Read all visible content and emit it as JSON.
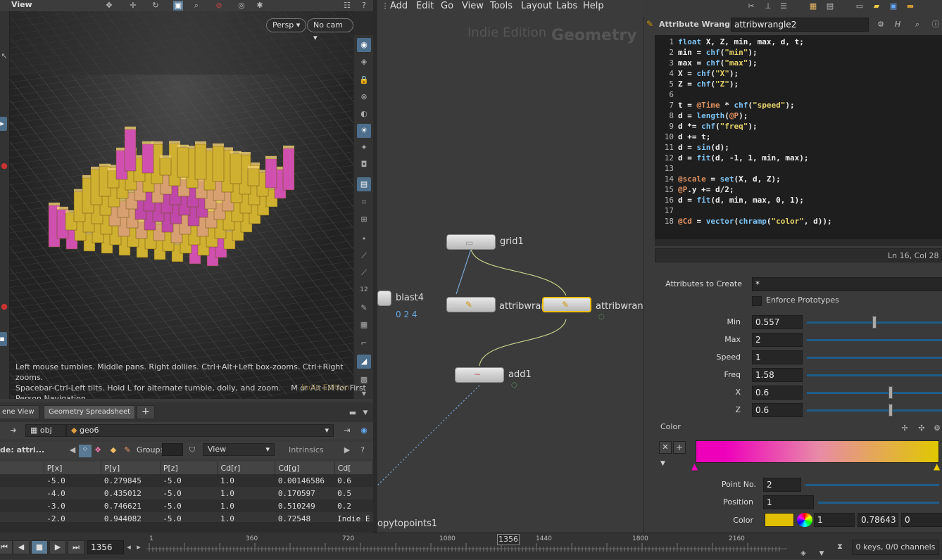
{
  "viewport": {
    "title": "View",
    "camera_view": "Persp",
    "camera": "No cam",
    "help_line1": "Left mouse tumbles. Middle pans. Right dollies. Ctrl+Alt+Left box-zooms. Ctrl+Right zooms.",
    "help_line2": "Spacebar-Ctrl-Left tilts. Hold L for alternate tumble, dolly, and zoom.    M or Alt+M for First",
    "help_line3": "Person Navigation.",
    "watermark": "Indie Edition"
  },
  "sheet": {
    "tabs": [
      "ene View",
      "Geometry Spreadsheet",
      "+"
    ],
    "path": [
      "obj",
      "geo6"
    ],
    "node_label": "de: attri...",
    "group_label": "Group:",
    "view_label": "View",
    "intrinsics_label": "Intrinsics",
    "headers": [
      "",
      "P[x]",
      "P[y]",
      "P[z]",
      "Cd[r]",
      "Cd[g]",
      "Cd["
    ],
    "rows": [
      [
        "",
        "-5.0",
        "0.279845",
        "-5.0",
        "1.0",
        "0.00146586",
        "0.6"
      ],
      [
        "",
        "-4.0",
        "0.435012",
        "-5.0",
        "1.0",
        "0.170597",
        "0.5"
      ],
      [
        "",
        "-3.0",
        "0.746621",
        "-5.0",
        "1.0",
        "0.510249",
        "0.2"
      ],
      [
        "",
        "-2.0",
        "0.944082",
        "-5.0",
        "1.0",
        "0.72548",
        "Indie E"
      ]
    ]
  },
  "network": {
    "menu": [
      "Add",
      "Edit",
      "Go",
      "View",
      "Tools",
      "Layout",
      "Labs",
      "Help"
    ],
    "watermark_indie": "Indie Edition",
    "watermark_context": "Geometry",
    "nodes": {
      "grid": "grid1",
      "blast": "blast4",
      "blast_sub": "0 2 4",
      "wrangle1": "attribwran",
      "wrangle2": "attribwran",
      "add": "add1",
      "copy": "opytopoints1"
    }
  },
  "params": {
    "node_type": "Attribute Wrangle",
    "node_name": "attribwrangle2",
    "code_lines": [
      "float X, Z, min, max, d, t;",
      "min = chf(\"min\");",
      "max = chf(\"max\");",
      "X = chf(\"X\");",
      "Z = chf(\"Z\");",
      "",
      "t = @Time * chf(\"speed\");",
      "d = length(@P);",
      "d *= chf(\"freq\");",
      "d += t;",
      "d = sin(d);",
      "d = fit(d, -1, 1, min, max);",
      "",
      "@scale = set(X, d, Z);",
      "@P.y += d/2;",
      "d = fit(d, min, max, 0, 1);",
      "",
      "@Cd = vector(chramp(\"color\", d));"
    ],
    "cursor_pos": "Ln 16, Col 28",
    "attributes_to_create_label": "Attributes to Create",
    "attributes_to_create": "*",
    "enforce_prototypes": "Enforce Prototypes",
    "sliders": [
      {
        "label": "Min",
        "value": "0.557",
        "frac": 0.48
      },
      {
        "label": "Max",
        "value": "2",
        "frac": 0.0
      },
      {
        "label": "Speed",
        "value": "1",
        "frac": 0.0
      },
      {
        "label": "Freq",
        "value": "1.58",
        "frac": 0.0
      },
      {
        "label": "X",
        "value": "0.6",
        "frac": 0.6
      },
      {
        "label": "Z",
        "value": "0.6",
        "frac": 0.6
      }
    ],
    "color_label": "Color",
    "ramp_left": "#ee00bb",
    "ramp_right": "#e0c800",
    "point_no_label": "Point No.",
    "point_no": "2",
    "position_label": "Position",
    "position": "1",
    "color_row_label": "Color",
    "color_r": "1",
    "color_g": "0.78643",
    "color_b": "0",
    "swatch": "#e0c000"
  },
  "timeline": {
    "frame": "1356",
    "marker": "1356",
    "ticks": [
      "1",
      "360",
      "720",
      "1080",
      "1440",
      "1800",
      "2160"
    ],
    "keys": "0 keys, 0/0 channels"
  }
}
